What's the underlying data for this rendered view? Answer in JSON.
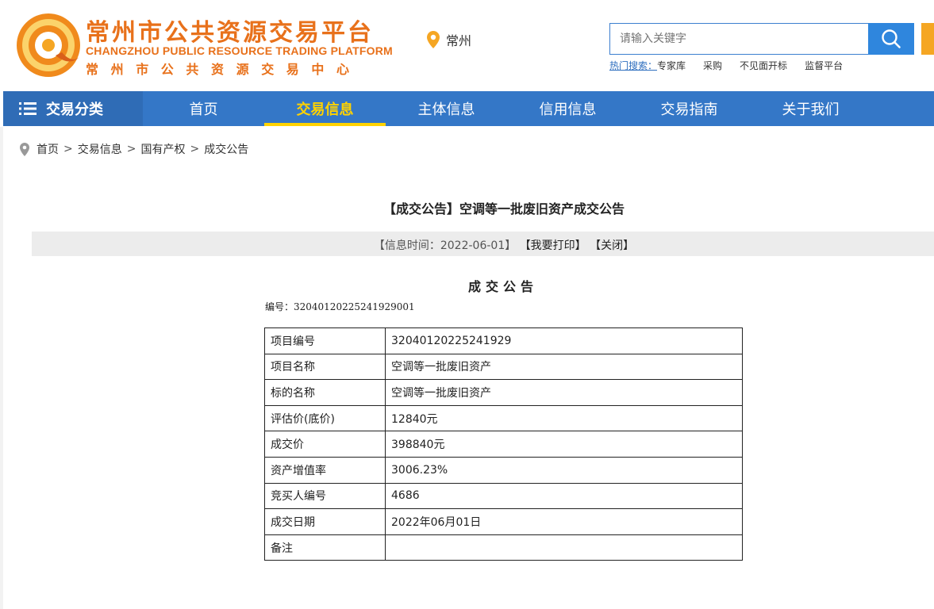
{
  "brand": {
    "name_cn": "常州市公共资源交易平台",
    "name_en": "CHANGZHOU PUBLIC RESOURCE TRADING PLATFORM",
    "center_cn": "常州市公共资源交易中心",
    "accent_color": "#e8711b"
  },
  "location": {
    "icon": "map-pin-icon",
    "city": "常州"
  },
  "search": {
    "placeholder": "请输入关键字",
    "button_icon": "search-icon",
    "hot_label": "热门搜索：",
    "hot_items": [
      "专家库",
      "采购",
      "不见面开标",
      "监督平台"
    ]
  },
  "nav": {
    "category_label": "交易分类",
    "items": [
      "首页",
      "交易信息",
      "主体信息",
      "信用信息",
      "交易指南",
      "关于我们"
    ],
    "active": "交易信息",
    "bar_color": "#3477c7",
    "active_color": "#ffd200"
  },
  "breadcrumb": [
    "首页",
    "交易信息",
    "国有产权",
    "成交公告"
  ],
  "article": {
    "title": "【成交公告】空调等一批废旧资产成交公告",
    "info_time": "【信息时间：2022-06-01】",
    "print_label": "【我要打印】",
    "close_label": "【关闭】",
    "heading": "成交公告",
    "number_line": "编号：32040120225241929001",
    "rows": [
      {
        "label": "项目编号",
        "value": "32040120225241929"
      },
      {
        "label": "项目名称",
        "value": "空调等一批废旧资产"
      },
      {
        "label": "标的名称",
        "value": "空调等一批废旧资产"
      },
      {
        "label": "评估价(底价)",
        "value": "12840元"
      },
      {
        "label": "成交价",
        "value": "398840元"
      },
      {
        "label": "资产增值率",
        "value": "3006.23%"
      },
      {
        "label": "竞买人编号",
        "value": "4686"
      },
      {
        "label": "成交日期",
        "value": "2022年06月01日"
      },
      {
        "label": "备注",
        "value": ""
      }
    ]
  }
}
